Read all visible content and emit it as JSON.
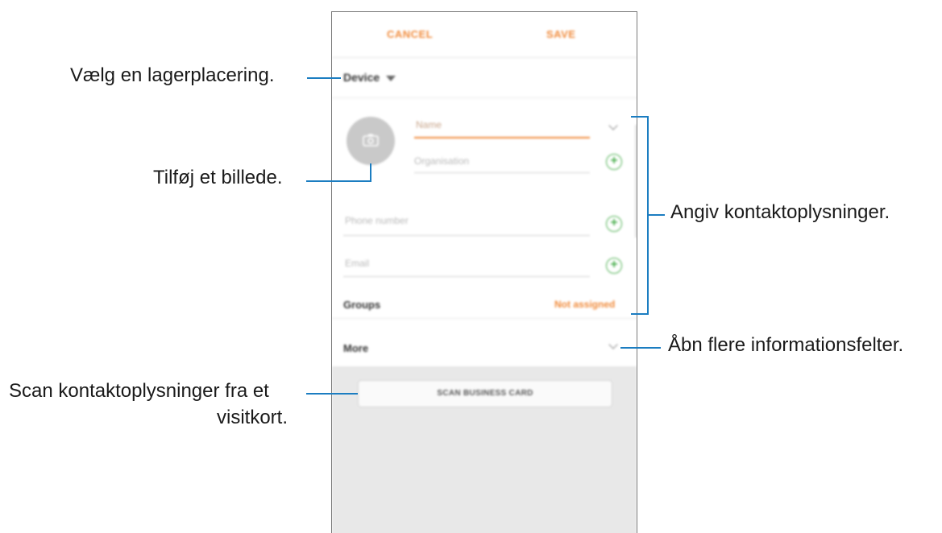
{
  "screen": {
    "topbar": {
      "cancel_label": "CANCEL",
      "save_label": "SAVE"
    },
    "storage_location": {
      "label": "Device",
      "icon": "dropdown-triangle-icon"
    },
    "photo": {
      "icon": "camera-icon"
    },
    "fields": {
      "name_placeholder": "Name",
      "organisation_placeholder": "Organisation",
      "phone_placeholder": "Phone number",
      "email_placeholder": "Email"
    },
    "groups": {
      "label": "Groups",
      "value": "Not assigned"
    },
    "more": {
      "label": "More"
    },
    "scan_button_label": "SCAN BUSINESS CARD",
    "colors": {
      "accent": "#f08a3a",
      "add_icon": "#4caf50",
      "callout_line": "#1b7dc1"
    }
  },
  "callouts": {
    "storage": "Vælg en lagerplacering.",
    "photo": "Tilføj et billede.",
    "contact_info": "Angiv kontaktoplysninger.",
    "more_fields": "Åbn flere informationsfelter.",
    "scan_line1": "Scan kontaktoplysninger fra et",
    "scan_line2": "visitkort."
  }
}
